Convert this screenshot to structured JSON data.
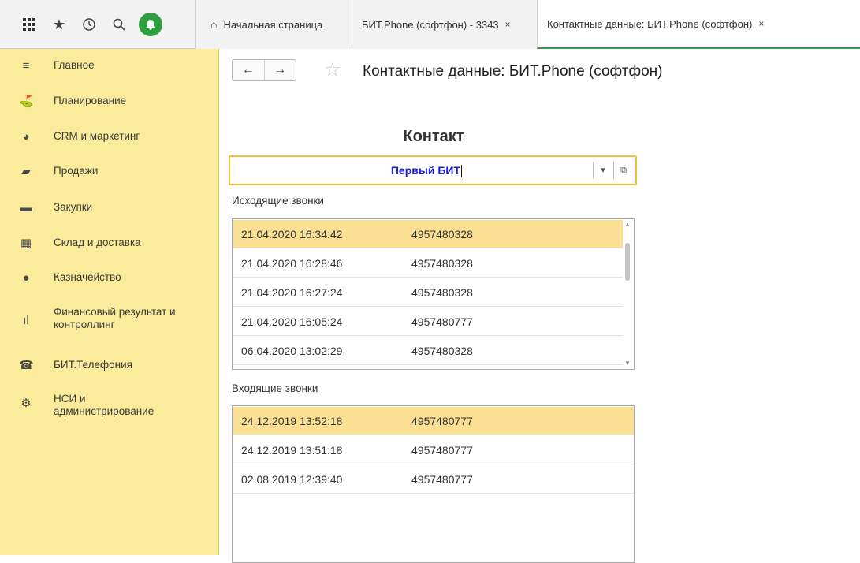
{
  "toolbar": {
    "icons": [
      "apps-grid-icon",
      "star-icon",
      "history-icon",
      "search-icon",
      "bell-icon"
    ]
  },
  "tabs": [
    {
      "label": "Начальная страница",
      "icon": "home-icon"
    },
    {
      "label": "БИТ.Phone (софтфон) - 3343",
      "close": "×"
    },
    {
      "label": "Контактные данные: БИТ.Phone (софтфон)",
      "close": "×"
    }
  ],
  "sidebar": {
    "items": [
      {
        "label": "Главное",
        "icon": "menu-lines-icon"
      },
      {
        "label": "Планирование",
        "icon": "planning-icon"
      },
      {
        "label": "CRM и маркетинг",
        "icon": "pie-chart-icon"
      },
      {
        "label": "Продажи",
        "icon": "shopping-bag-icon"
      },
      {
        "label": "Закупки",
        "icon": "cart-icon"
      },
      {
        "label": "Склад и доставка",
        "icon": "warehouse-icon"
      },
      {
        "label": "Казначейство",
        "icon": "ruble-coin-icon"
      },
      {
        "label": "Финансовый результат и",
        "label2": "контроллинг",
        "icon": "bar-chart-icon"
      },
      {
        "label": "БИТ.Телефония",
        "icon": "telephone-icon"
      },
      {
        "label": "НСИ и",
        "label2": "администрирование",
        "icon": "gear-icon"
      }
    ]
  },
  "nav": {
    "back": "←",
    "forward": "→",
    "favorite": "☆"
  },
  "page": {
    "title": "Контактные данные: БИТ.Phone (софтфон)",
    "contact_heading": "Контакт",
    "contact_value": "Первый БИТ",
    "dropdown_glyph": "▾",
    "open_glyph": "⧉"
  },
  "outgoing": {
    "label": "Исходящие звонки",
    "rows": [
      {
        "date": "21.04.2020 16:34:42",
        "phone": "4957480328"
      },
      {
        "date": "21.04.2020 16:28:46",
        "phone": "4957480328"
      },
      {
        "date": "21.04.2020 16:27:24",
        "phone": "4957480328"
      },
      {
        "date": "21.04.2020 16:05:24",
        "phone": "4957480777"
      },
      {
        "date": "06.04.2020 13:02:29",
        "phone": "4957480328"
      }
    ],
    "selected_index": 0
  },
  "incoming": {
    "label": "Входящие звонки",
    "rows": [
      {
        "date": "24.12.2019 13:52:18",
        "phone": "4957480777"
      },
      {
        "date": "24.12.2019 13:51:18",
        "phone": "4957480777"
      },
      {
        "date": "02.08.2019 12:39:40",
        "phone": "4957480777"
      }
    ],
    "selected_index": 0
  },
  "colors": {
    "sidebar_bg": "#fbec9c",
    "selected_row": "#fbdf93",
    "field_border": "#f0c33c",
    "contact_text": "#1a1ad6",
    "active_tab_underline": "#3c9a45",
    "bell_bg": "#2e9e3e"
  }
}
